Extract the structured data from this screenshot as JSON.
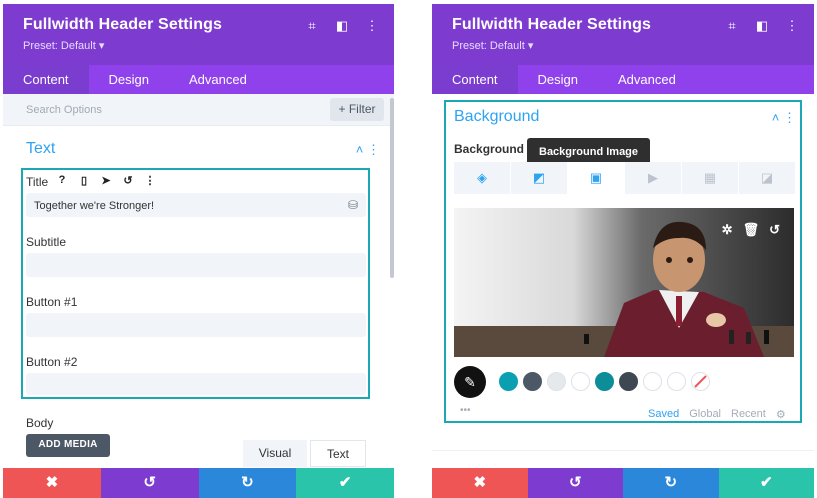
{
  "left": {
    "title": "Fullwidth Header Settings",
    "preset": "Preset: Default ▾",
    "header_icons": [
      "⌗",
      "◧",
      "⋮"
    ],
    "tabs": [
      {
        "label": "Content"
      },
      {
        "label": "Design"
      },
      {
        "label": "Advanced"
      }
    ],
    "search_placeholder": "Search Options",
    "filter_label": "+ Filter",
    "section_title": "Text",
    "section_ctrl": "˄  ⋮",
    "title_label": "Title",
    "title_icons": [
      "?",
      "▯",
      "➤",
      "↺",
      "⋮"
    ],
    "title_value": "Together we're Stronger!",
    "dynamic_icon": "⛁",
    "subtitle_label": "Subtitle",
    "button1_label": "Button #1",
    "button2_label": "Button #2",
    "body_label": "Body",
    "add_media": "ADD MEDIA",
    "editor_tabs": [
      "Visual",
      "Text"
    ],
    "footer": [
      "✖",
      "↺",
      "↻",
      "✔"
    ]
  },
  "right": {
    "title": "Fullwidth Header Settings",
    "preset": "Preset: Default ▾",
    "header_icons": [
      "⌗",
      "◧",
      "⋮"
    ],
    "tabs": [
      {
        "label": "Content"
      },
      {
        "label": "Design"
      },
      {
        "label": "Advanced"
      }
    ],
    "section_title": "Background",
    "section_ctrl": "˄  ⋮",
    "bg_label": "Background",
    "tooltip": "Background Image",
    "bg_tab_icons": [
      "◈",
      "◩",
      "▣",
      "▶",
      "▦",
      "◪"
    ],
    "photo_controls": [
      "✲",
      "🗑",
      "↺"
    ],
    "picker_icon": "✎",
    "palette": [
      "#0c9fb2",
      "#4c5866",
      "#e6e9ec",
      "#ffffff",
      "#0c8d97",
      "#3f4852",
      "#ffffff",
      "#ffffff",
      "none"
    ],
    "more": "•••",
    "palette_tabs": [
      "Saved",
      "Global",
      "Recent",
      "⚙"
    ],
    "footer": [
      "✖",
      "↺",
      "↻",
      "✔"
    ]
  },
  "colors": {
    "header": "#7e3bd0",
    "tabs": "#8f42ec",
    "accent": "#2ea3f2",
    "highlight": "#1aa8b4"
  }
}
